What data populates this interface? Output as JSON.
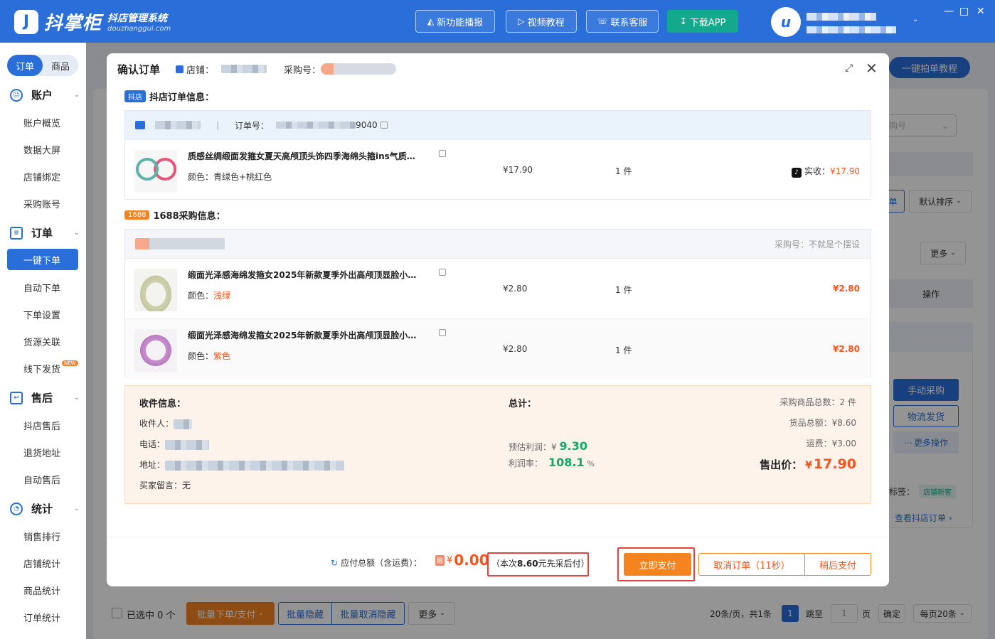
{
  "app": {
    "name": "抖掌柜",
    "subtitle": "抖店管理系统",
    "domain": "douzhanggui.com",
    "top_buttons": [
      "新功能播报",
      "视频教程",
      "联系客服",
      "下载APP"
    ]
  },
  "sidebar": {
    "tabs": [
      "订单",
      "商品"
    ],
    "groups": [
      {
        "label": "账户",
        "items": [
          "账户概览",
          "数据大屏",
          "店铺绑定",
          "采购账号"
        ]
      },
      {
        "label": "订单",
        "items": [
          "一键下单",
          "自动下单",
          "下单设置",
          "货源关联",
          "线下发货"
        ]
      },
      {
        "label": "售后",
        "items": [
          "抖店售后",
          "退货地址",
          "自动售后"
        ]
      },
      {
        "label": "统计",
        "items": [
          "销售排行",
          "店铺统计",
          "商品统计",
          "订单统计"
        ]
      }
    ],
    "new_badge": "NEW"
  },
  "background": {
    "tutorial_button": "一键拍单教程",
    "select_placeholder": "购号",
    "char_dan": "单",
    "sort": "默认排序",
    "more": "更多",
    "operation": "操作",
    "manual_purchase": "手动采购",
    "logistics": "物流发货",
    "more_ops": "更多操作",
    "tag_label": "标签：",
    "tag_value": "店铺新客",
    "view_order": "查看抖店订单",
    "selected": "已选中 0 个",
    "batch_order": "批量下单/支付",
    "batch_hide": "批量隐藏",
    "batch_unhide": "批量取消隐藏",
    "more_btn": "更多",
    "pagination": {
      "info": "20条/页，共1条",
      "page": "1",
      "jump": "跳至",
      "jump_value": "1",
      "page_unit": "页",
      "confirm": "确定",
      "per_page": "每页20条"
    }
  },
  "modal": {
    "title": "确认订单",
    "store_label": "店铺：",
    "purchase_label": "采购号：",
    "douyin_section": {
      "tag": "抖店",
      "title": "抖店订单信息："
    },
    "douyin_order": {
      "order_label": "订单号：",
      "order_suffix": "9040",
      "product": {
        "title": "质感丝绸缎面发箍女夏天高颅顶头饰四季海绵头箍ins气质…",
        "spec_label": "颜色：",
        "spec": "青绿色+桃红色",
        "price": "¥17.90",
        "qty": "1 件",
        "received_label": "实收：",
        "received": "¥17.90"
      }
    },
    "purchase_section": {
      "tag": "1688",
      "title": "1688采购信息："
    },
    "purchase_account_note": "采购号：不就是个摆设",
    "purchase_items": [
      {
        "title": "缎面光泽感海绵发箍女2025年新款夏季外出高颅顶显脸小…",
        "spec_label": "颜色：",
        "spec": "浅绿",
        "price": "¥2.80",
        "qty": "1 件",
        "total": "¥2.80"
      },
      {
        "title": "缎面光泽感海绵发箍女2025年新款夏季外出高颅顶显脸小…",
        "spec_label": "颜色：",
        "spec": "紫色",
        "price": "¥2.80",
        "qty": "1 件",
        "total": "¥2.80"
      }
    ],
    "receiver": {
      "title": "收件信息：",
      "name_label": "收件人：",
      "phone_label": "电话：",
      "address_label": "地址：",
      "note_label": "买家留言：",
      "note": "无"
    },
    "totals": {
      "title": "总计：",
      "profit_label": "预估利润：",
      "profit_currency": "¥",
      "profit": "9.30",
      "margin_label": "利润率：",
      "margin": "108.1",
      "margin_unit": "%",
      "item_count": "采购商品总数：2 件",
      "goods_total": "货品总额：¥8.60",
      "shipping": "运费：¥3.00",
      "sale_label": "售出价：",
      "sale_currency": "¥",
      "sale_price": "17.90"
    },
    "footer": {
      "payable_label": "应付总额（含运费）：",
      "credit_tag": "赊",
      "currency": "¥",
      "amount": "0.00",
      "note_prefix": "（本次",
      "note_amount": "8.60",
      "note_suffix": "元先采后付）",
      "pay_now": "立即支付",
      "cancel": "取消订单（11秒）",
      "pay_later": "稍后支付"
    }
  },
  "colors": {
    "primary": "#2a6fd9",
    "accent": "#f5841f",
    "price_red": "#f5541b",
    "profit_green": "#13a86a",
    "highlight": "#e7413d"
  }
}
